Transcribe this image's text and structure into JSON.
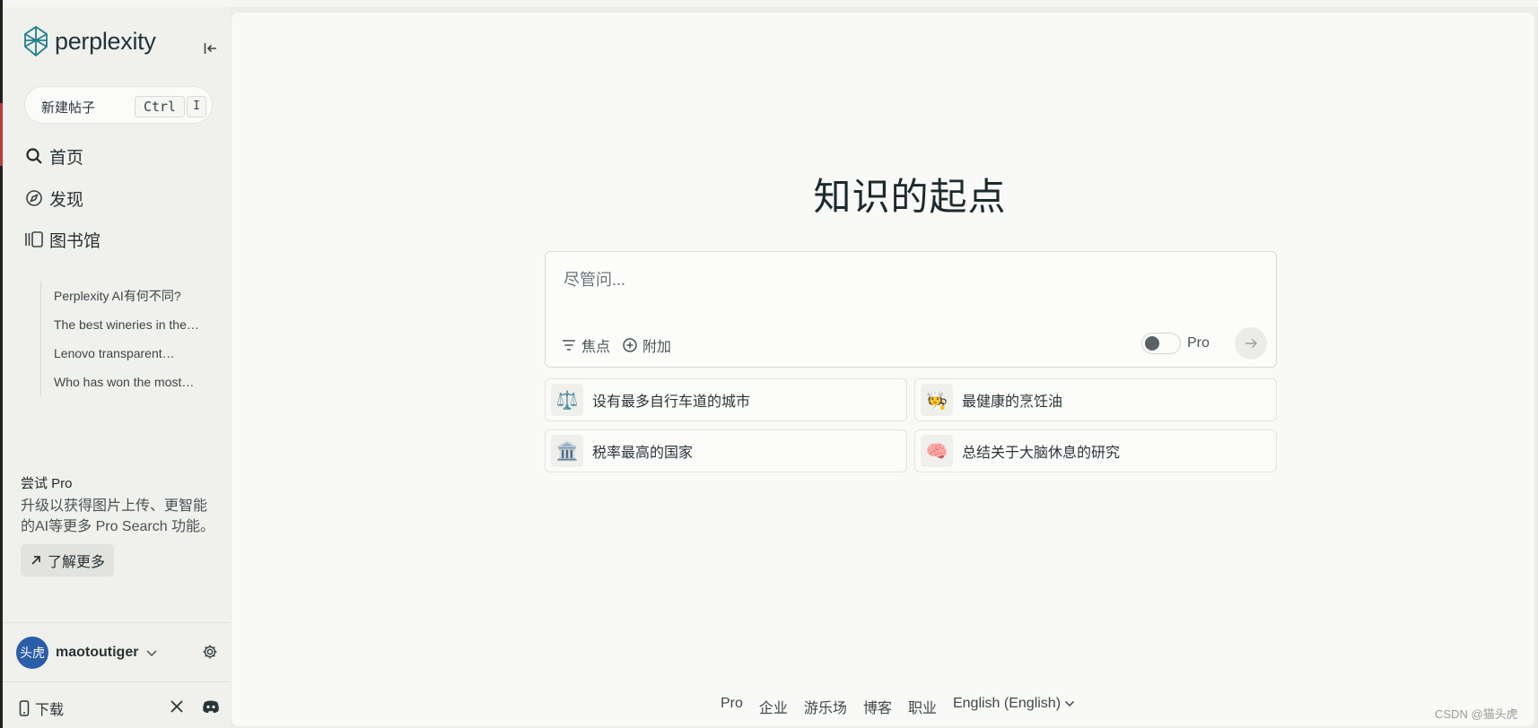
{
  "brand": {
    "name": "perplexity",
    "accent": "#20808d"
  },
  "sidebar": {
    "new_thread": {
      "label": "新建帖子",
      "shortcut_keys": [
        "Ctrl",
        "I"
      ]
    },
    "nav": [
      {
        "label": "首页",
        "icon": "search-icon"
      },
      {
        "label": "发现",
        "icon": "compass-icon"
      },
      {
        "label": "图书馆",
        "icon": "library-icon"
      }
    ],
    "library_items": [
      "Perplexity AI有何不同?",
      "The best wineries in the…",
      "Lenovo transparent…",
      "Who has won the most…"
    ],
    "promo": {
      "title": "尝试 Pro",
      "description": "升级以获得图片上传、更智能的AI等更多 Pro Search 功能。",
      "button": "了解更多"
    },
    "user": {
      "avatar_text": "头虎",
      "name": "maotoutiger"
    },
    "download_label": "下载"
  },
  "main": {
    "headline": "知识的起点",
    "ask": {
      "placeholder": "尽管问...",
      "focus_label": "焦点",
      "attach_label": "附加",
      "pro_label": "Pro",
      "pro_enabled": false
    },
    "suggestions": [
      {
        "emoji": "⚖️",
        "text": "设有最多自行车道的城市"
      },
      {
        "emoji": "🧑‍🍳",
        "text": "最健康的烹饪油"
      },
      {
        "emoji": "🏛️",
        "text": "税率最高的国家"
      },
      {
        "emoji": "🧠",
        "text": "总结关于大脑休息的研究"
      }
    ],
    "footer_links": [
      "Pro",
      "企业",
      "游乐场",
      "博客",
      "职业",
      "English (English)"
    ]
  },
  "watermark": "CSDN @猫头虎"
}
